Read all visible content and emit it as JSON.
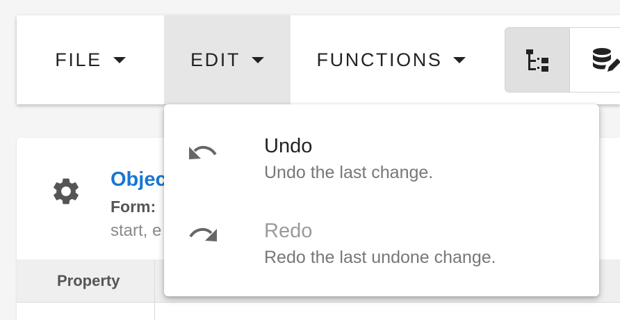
{
  "toolbar": {
    "file_label": "FILE",
    "edit_label": "EDIT",
    "functions_label": "FUNCTIONS",
    "toggles": [
      {
        "icon": "tree-view-icon",
        "active": true
      },
      {
        "icon": "database-edit-icon",
        "active": false
      }
    ]
  },
  "panel": {
    "icon": "gear-icon",
    "title": "Objec",
    "form_label": "Form:",
    "subtitle": "start, e",
    "table_header_property": "Property"
  },
  "edit_menu": {
    "items": [
      {
        "label": "Undo",
        "description": "Undo the last change.",
        "icon": "undo-icon",
        "enabled": true
      },
      {
        "label": "Redo",
        "description": "Redo the last undone change.",
        "icon": "redo-icon",
        "enabled": false
      }
    ]
  },
  "colors": {
    "accent": "#1976d2",
    "active_bg": "#e6e6e6",
    "text_primary": "#222222",
    "text_secondary": "#777777",
    "text_disabled": "#9a9a9a"
  }
}
